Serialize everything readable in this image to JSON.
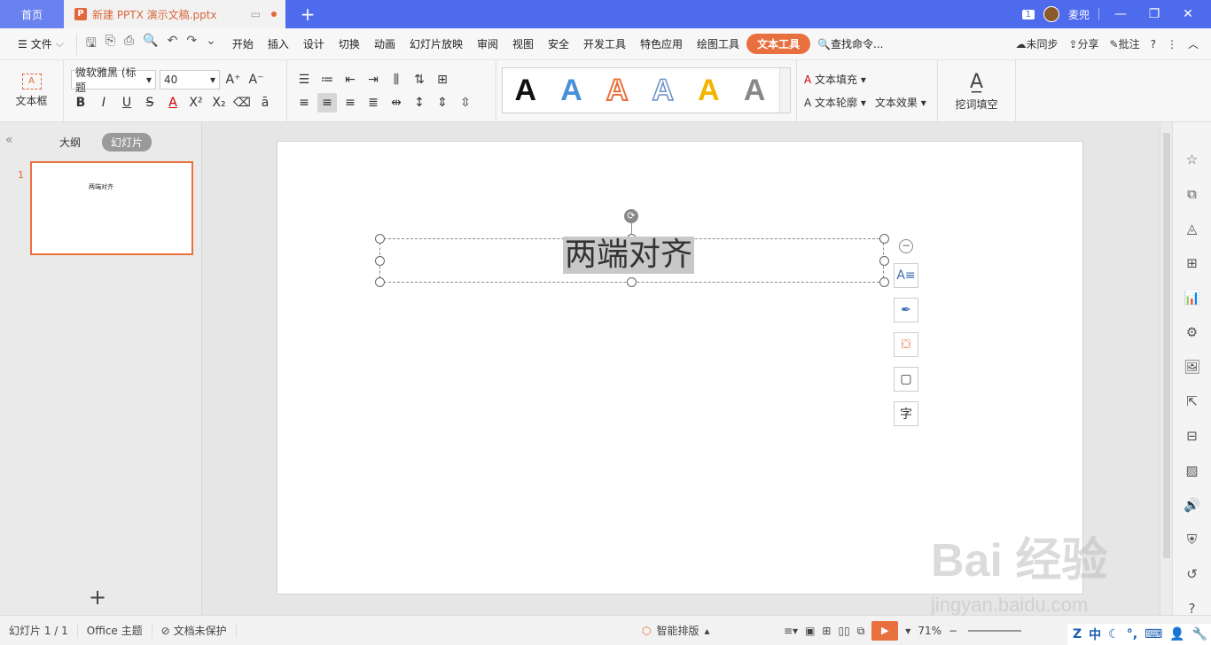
{
  "titlebar": {
    "home_tab": "首页",
    "doc_tab": "新建 PPTX 演示文稿.pptx",
    "doc_icon": "P",
    "window_count": "1",
    "user_name": "麦兜"
  },
  "menu": {
    "file": "文件",
    "tabs": [
      "开始",
      "插入",
      "设计",
      "切换",
      "动画",
      "幻灯片放映",
      "审阅",
      "视图",
      "安全",
      "开发工具",
      "特色应用",
      "绘图工具",
      "文本工具"
    ],
    "active_tab": "文本工具",
    "search": "查找命令...",
    "sync": "未同步",
    "share": "分享",
    "comment": "批注"
  },
  "ribbon": {
    "textbox_label": "文本框",
    "textbox_icon_text": "A",
    "font_name": "微软雅黑 (标题",
    "font_size": "40",
    "art_letter": "A",
    "text_fill": "文本填充",
    "text_outline": "文本轮廓",
    "text_effect": "文本效果",
    "cloze": "挖词填空"
  },
  "left_panel": {
    "tab_outline": "大纲",
    "tab_slides": "幻灯片",
    "slide_number": "1",
    "slide_thumb_text": "两端对齐",
    "add_slide": "+"
  },
  "slide": {
    "title_text": "两端对齐"
  },
  "statusbar": {
    "slide_info": "幻灯片 1 / 1",
    "theme": "Office 主题",
    "protect": "文档未保护",
    "smart_layout": "智能排版",
    "zoom": "71%"
  },
  "watermark": {
    "line1": "Bai 经验",
    "line2": "jingyan.baidu.com"
  },
  "tray": {
    "ime": "中"
  },
  "colors": {
    "titlebar": "#4f6bed",
    "accent": "#e8703f",
    "art_styles": [
      "#111111",
      "#4a90d9",
      "#e8703f",
      "#6a8fc7",
      "#f2b600",
      "#888888"
    ]
  }
}
